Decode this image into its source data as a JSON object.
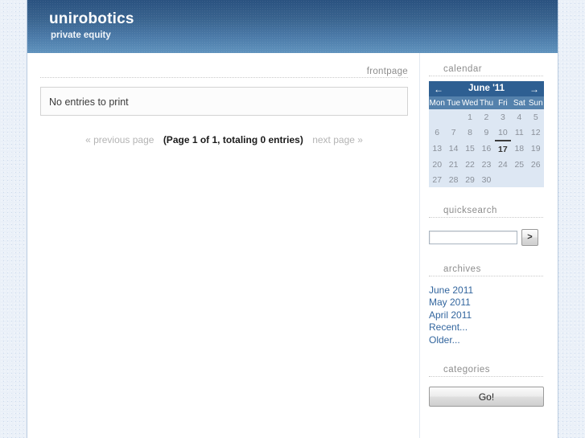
{
  "site": {
    "title": "unirobotics",
    "subtitle": "private equity"
  },
  "content": {
    "section_label": "frontpage",
    "entry_placeholder_text": "No entries to print",
    "pagination": {
      "previous_label": "« previous page",
      "current_label": "(Page 1 of 1, totaling 0 entries)",
      "next_label": "next page »",
      "page": 1,
      "total_pages": 1,
      "total_entries": 0
    }
  },
  "sidebar": {
    "calendar": {
      "title": "calendar",
      "month_label": "June '11",
      "prev_arrow": "←",
      "next_arrow": "→",
      "weekdays": [
        "Mon",
        "Tue",
        "Wed",
        "Thu",
        "Fri",
        "Sat",
        "Sun"
      ],
      "weeks": [
        [
          "",
          "",
          "1",
          "2",
          "3",
          "4",
          "5"
        ],
        [
          "6",
          "7",
          "8",
          "9",
          "10",
          "11",
          "12"
        ],
        [
          "13",
          "14",
          "15",
          "16",
          "17",
          "18",
          "19"
        ],
        [
          "20",
          "21",
          "22",
          "23",
          "24",
          "25",
          "26"
        ],
        [
          "27",
          "28",
          "29",
          "30",
          "",
          "",
          ""
        ]
      ],
      "today": "17"
    },
    "quicksearch": {
      "title": "quicksearch",
      "input_value": "",
      "input_placeholder": "",
      "submit_label": ">"
    },
    "archives": {
      "title": "archives",
      "items": [
        {
          "label": "June 2011"
        },
        {
          "label": "May 2011"
        },
        {
          "label": "April 2011"
        },
        {
          "label": "Recent..."
        },
        {
          "label": "Older..."
        }
      ]
    },
    "categories": {
      "title": "categories",
      "go_label": "Go!"
    }
  },
  "colors": {
    "banner_top": "#2a5280",
    "banner_bottom": "#6093bd",
    "calendar_header": "#2e5f92",
    "calendar_weekday": "#5481ac",
    "calendar_body": "#dde7f3",
    "link": "#33669e",
    "page_background": "#eaf0f8"
  }
}
